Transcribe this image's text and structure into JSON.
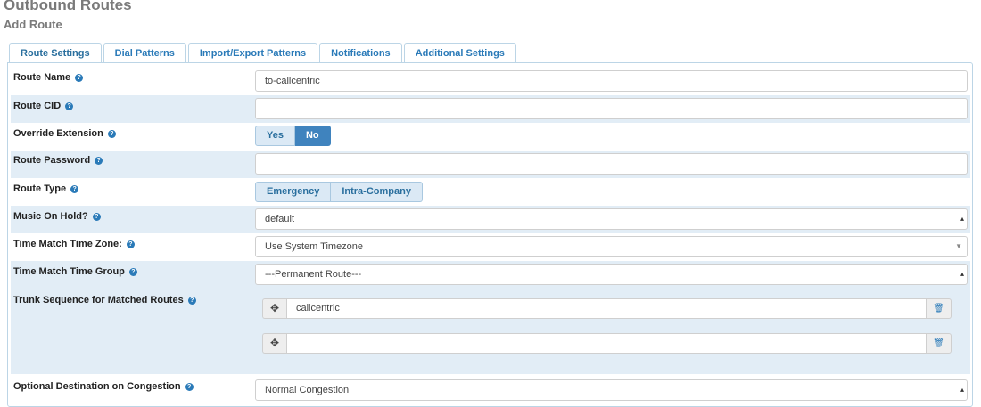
{
  "header": {
    "title": "Outbound Routes",
    "subtitle": "Add Route"
  },
  "tabs": [
    {
      "label": "Route Settings",
      "active": true
    },
    {
      "label": "Dial Patterns",
      "active": false
    },
    {
      "label": "Import/Export Patterns",
      "active": false
    },
    {
      "label": "Notifications",
      "active": false
    },
    {
      "label": "Additional Settings",
      "active": false
    }
  ],
  "form": {
    "route_name": {
      "label": "Route Name",
      "value": "to-callcentric"
    },
    "route_cid": {
      "label": "Route CID",
      "value": ""
    },
    "override_extension": {
      "label": "Override Extension",
      "options": [
        "Yes",
        "No"
      ],
      "selected": "No"
    },
    "route_password": {
      "label": "Route Password",
      "value": ""
    },
    "route_type": {
      "label": "Route Type",
      "options": [
        "Emergency",
        "Intra-Company"
      ]
    },
    "music_on_hold": {
      "label": "Music On Hold?",
      "value": "default"
    },
    "time_zone": {
      "label": "Time Match Time Zone:",
      "value": "Use System Timezone"
    },
    "time_group": {
      "label": "Time Match Time Group",
      "value": "---Permanent Route---"
    },
    "trunk_sequence": {
      "label": "Trunk Sequence for Matched Routes",
      "trunks": [
        "callcentric",
        ""
      ]
    },
    "congestion": {
      "label": "Optional Destination on Congestion",
      "value": "Normal Congestion"
    }
  },
  "icons": {
    "help": "question-circle-icon",
    "drag": "move-arrows-icon",
    "delete": "trash-icon"
  },
  "colors": {
    "accent": "#2a7ab8",
    "selected_button": "#3f83be",
    "shaded_row": "#e2edf6"
  }
}
